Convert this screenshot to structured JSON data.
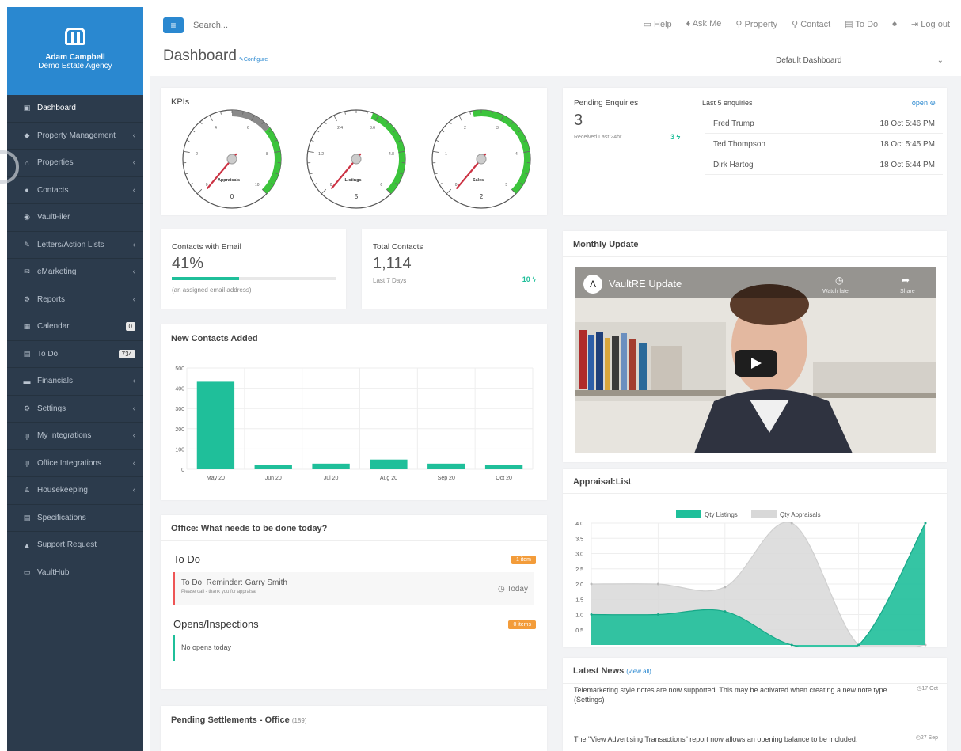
{
  "profile": {
    "name": "Adam Campbell",
    "agency": "Demo Estate Agency"
  },
  "nav": [
    {
      "label": "Dashboard",
      "icon": "dashboard-icon",
      "glyph": "▣",
      "chev": false
    },
    {
      "label": "Property Management",
      "icon": "shield-icon",
      "glyph": "◆",
      "chev": true
    },
    {
      "label": "Properties",
      "icon": "home-icon",
      "glyph": "⌂",
      "chev": true
    },
    {
      "label": "Contacts",
      "icon": "user-icon",
      "glyph": "●",
      "chev": true
    },
    {
      "label": "VaultFiler",
      "icon": "users-icon",
      "glyph": "◉",
      "chev": false
    },
    {
      "label": "Letters/Action Lists",
      "icon": "edit-icon",
      "glyph": "✎",
      "chev": true
    },
    {
      "label": "eMarketing",
      "icon": "envelope-icon",
      "glyph": "✉",
      "chev": true
    },
    {
      "label": "Reports",
      "icon": "gear-icon",
      "glyph": "⚙",
      "chev": true
    },
    {
      "label": "Calendar",
      "icon": "calendar-icon",
      "glyph": "▦",
      "badge": "0"
    },
    {
      "label": "To Do",
      "icon": "list-icon",
      "glyph": "▤",
      "badge": "734"
    },
    {
      "label": "Financials",
      "icon": "money-icon",
      "glyph": "▬",
      "chev": true
    },
    {
      "label": "Settings",
      "icon": "settings-icon",
      "glyph": "⚙",
      "chev": true
    },
    {
      "label": "My Integrations",
      "icon": "plug-icon",
      "glyph": "ψ",
      "chev": true
    },
    {
      "label": "Office Integrations",
      "icon": "plug-icon",
      "glyph": "ψ",
      "chev": true
    },
    {
      "label": "Housekeeping",
      "icon": "broom-icon",
      "glyph": "♙",
      "chev": true
    },
    {
      "label": "Specifications",
      "icon": "document-icon",
      "glyph": "▤",
      "chev": false
    },
    {
      "label": "Support Request",
      "icon": "support-icon",
      "glyph": "▲",
      "chev": false
    },
    {
      "label": "VaultHub",
      "icon": "monitor-icon",
      "glyph": "▭",
      "chev": false
    }
  ],
  "topbar": {
    "search_placeholder": "Search...",
    "links": [
      "Help",
      "Ask Me",
      "Property",
      "Contact",
      "To Do",
      "",
      "Log out"
    ]
  },
  "page": {
    "title": "Dashboard",
    "configure": "Configure",
    "dashboard_select": "Default Dashboard"
  },
  "kpis": {
    "title": "KPIs",
    "gauges": [
      {
        "label": "Appraisals",
        "value": "0",
        "ticks": [
          "0",
          "2",
          "4",
          "6",
          "8",
          "10"
        ]
      },
      {
        "label": "Listings",
        "value": "5",
        "ticks": [
          "0",
          "1.2",
          "2.4",
          "3.6",
          "4.8",
          "6"
        ]
      },
      {
        "label": "Sales",
        "value": "2",
        "ticks": [
          "0",
          "1",
          "2",
          "3",
          "4",
          "5"
        ]
      }
    ]
  },
  "enquiries": {
    "title": "Pending Enquiries",
    "count": "3",
    "sub": "Received Last 24hr",
    "delta": "3",
    "last_title": "Last 5 enquiries",
    "open_label": "open",
    "rows": [
      {
        "name": "Fred Trump",
        "date": "18 Oct 5:46 PM"
      },
      {
        "name": "Ted Thompson",
        "date": "18 Oct 5:45 PM"
      },
      {
        "name": "Dirk Hartog",
        "date": "18 Oct 5:44 PM"
      }
    ]
  },
  "contacts_email": {
    "title": "Contacts with Email",
    "value": "41%",
    "sub": "(an assigned email address)",
    "fraction": 0.41
  },
  "total_contacts": {
    "title": "Total Contacts",
    "value": "1,114",
    "sub": "Last 7 Days",
    "delta": "10"
  },
  "new_contacts": {
    "title": "New Contacts Added",
    "chart_data": {
      "type": "bar",
      "categories": [
        "May 20",
        "Jun 20",
        "Jul 20",
        "Aug 20",
        "Sep 20",
        "Oct 20"
      ],
      "values": [
        432,
        22,
        28,
        48,
        28,
        22
      ],
      "title": "",
      "xlabel": "",
      "ylabel": "",
      "ylim": [
        0,
        500
      ],
      "yticks": [
        "0",
        "100",
        "200",
        "300",
        "400",
        "500"
      ],
      "color": "#1fbf9a"
    }
  },
  "office_today": {
    "title": "Office: What needs to be done today?",
    "todo_heading": "To Do",
    "todo_badge": "1 item",
    "todo_item_title": "To Do: Reminder: Garry Smith",
    "todo_item_sub": "Please call - thank you for appraisal",
    "todo_item_time": "Today",
    "opens_heading": "Opens/Inspections",
    "opens_badge": "0 items",
    "opens_empty": "No opens today"
  },
  "pending_settlements": {
    "title": "Pending Settlements - Office",
    "count": "(189)"
  },
  "monthly_update": {
    "title": "Monthly Update",
    "video_title": "VaultRE Update",
    "watch_later": "Watch later",
    "share": "Share"
  },
  "appraisal_list": {
    "title": "Appraisal:List",
    "chart_data": {
      "type": "area",
      "x": [
        1,
        2,
        3,
        4,
        5,
        6
      ],
      "series": [
        {
          "name": "Qty Listings",
          "values": [
            1,
            1,
            1.1,
            0,
            0,
            4
          ],
          "color": "#1fbf9a"
        },
        {
          "name": "Qty Appraisals",
          "values": [
            2,
            2,
            1.9,
            4,
            0,
            0
          ],
          "color": "#d8d8d8"
        }
      ],
      "ylim": [
        0,
        4
      ],
      "yticks": [
        "0.5",
        "1.0",
        "1.5",
        "2.0",
        "2.5",
        "3.0",
        "3.5",
        "4.0"
      ],
      "legend": "top"
    }
  },
  "latest_news": {
    "title": "Latest News",
    "view_all": "(view all)",
    "items": [
      {
        "text": "Telemarketing style notes are now supported. This may be activated when creating a new note type (Settings)",
        "date": "17 Oct"
      },
      {
        "text": "The \"View Advertising Transactions\" report now allows an opening balance to be included.",
        "date": "27 Sep"
      }
    ]
  }
}
